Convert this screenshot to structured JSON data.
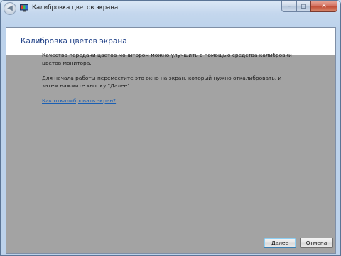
{
  "window": {
    "title": "Калибровка цветов экрана",
    "buttons": {
      "minimize": "–",
      "maximize": "□",
      "close": "✕"
    }
  },
  "header": {
    "title": "Калибровка цветов экрана"
  },
  "content": {
    "paragraph1": "Качество передачи цветов монитором можно улучшить с помощью средства калибровки цветов монитора.",
    "paragraph2": "Для начала работы переместите это окно на экран, который нужно откалибровать, и затем нажмите кнопку \"Далее\".",
    "help_link": "Как откалибровать экран?"
  },
  "footer": {
    "next_label": "Далее",
    "cancel_label": "Отмена"
  },
  "colors": {
    "dim_background": "#a3a3a3",
    "header_title": "#1e3f86",
    "link": "#1a5fb4"
  }
}
